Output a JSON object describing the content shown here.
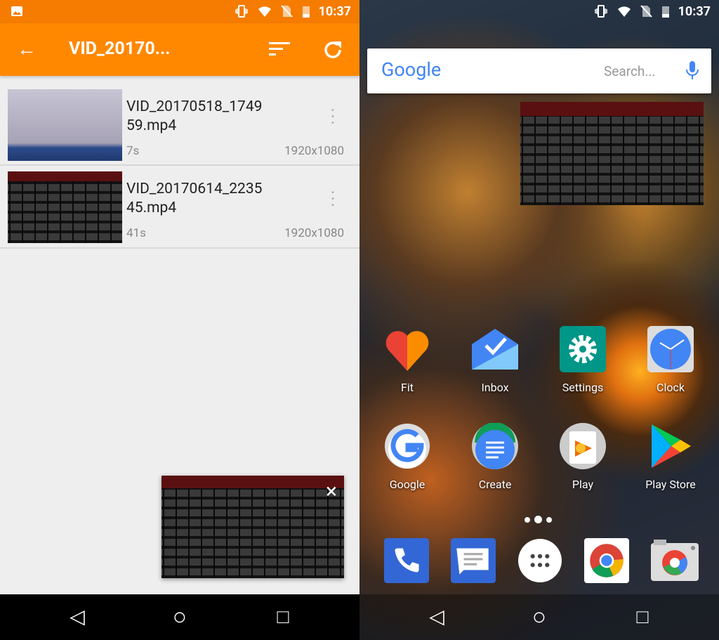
{
  "left": {
    "status": {
      "time": "10:37",
      "icons": [
        "image-icon",
        "vibrate-icon",
        "wifi-icon",
        "no-sim-icon",
        "battery-icon"
      ]
    },
    "toolbar": {
      "title": "VID_20170...",
      "back": "arrow-left-icon",
      "sort": "sort-icon",
      "refresh": "refresh-icon"
    },
    "videos": [
      {
        "name_line1": "VID_20170518_1749",
        "name_line2": "59.mp4",
        "duration": "7s",
        "resolution": "1920x1080"
      },
      {
        "name_line1": "VID_20170614_2235",
        "name_line2": "45.mp4",
        "duration": "41s",
        "resolution": "1920x1080"
      }
    ],
    "mini_player": {
      "close": "×"
    },
    "colors": {
      "accent": "#ff8800",
      "status_bar": "#f57c00"
    }
  },
  "right": {
    "status": {
      "time": "10:37"
    },
    "search": {
      "logo": "Google",
      "placeholder": "Search..."
    },
    "apps_row1": [
      {
        "label": "Fit"
      },
      {
        "label": "Inbox"
      },
      {
        "label": "Settings"
      },
      {
        "label": "Clock"
      }
    ],
    "apps_row2": [
      {
        "label": "Google"
      },
      {
        "label": "Create"
      },
      {
        "label": "Play"
      },
      {
        "label": "Play Store"
      }
    ],
    "dock": [
      "phone-icon",
      "messages-icon",
      "app-drawer-icon",
      "chrome-icon",
      "camera-icon"
    ]
  },
  "nav": {
    "back": "◁",
    "home": "○",
    "recents": "□"
  }
}
